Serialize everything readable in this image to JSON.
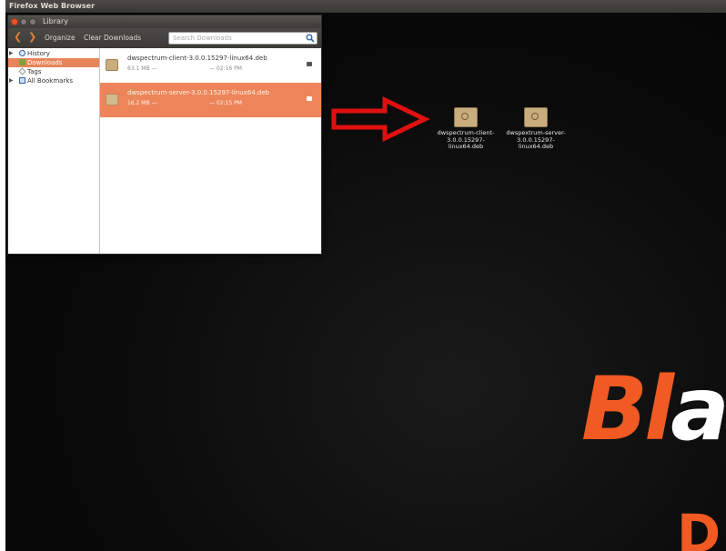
{
  "taskbar": {
    "title": "Firefox Web Browser"
  },
  "library": {
    "title": "Library",
    "toolbar": {
      "back_glyph": "❮",
      "forward_glyph": "❯",
      "organize_label": "Organize",
      "clear_downloads_label": "Clear Downloads",
      "search_placeholder": "Search Downloads"
    },
    "sidebar": {
      "items": [
        {
          "label": "History",
          "icon": "clock-icon"
        },
        {
          "label": "Downloads",
          "icon": "download-icon"
        },
        {
          "label": "Tags",
          "icon": "tag-icon"
        },
        {
          "label": "All Bookmarks",
          "icon": "bookmarks-icon"
        }
      ]
    },
    "downloads": [
      {
        "filename": "dwspectrum-client-3.0.0.15297-linux64.deb",
        "size": "63.1 MB —",
        "time": "— 02:16 PM",
        "selected": false
      },
      {
        "filename": "dwspectrum-server-3.0.0.15297-linux64.deb",
        "size": "16.2 MB —",
        "time": "— 02:15 PM",
        "selected": true
      }
    ]
  },
  "desktop": {
    "icons": [
      {
        "label": "dwspectrum-client-3.0.0.15297-linux64.deb",
        "icon": "debian-package-icon"
      },
      {
        "label": "dwspextrum-server-3.0.0.15297-linux64.deb",
        "icon": "debian-package-icon"
      }
    ],
    "brand_part1": "Bl",
    "brand_part2": "a",
    "brand_bottom": "D"
  },
  "colors": {
    "accent": "#ee855a",
    "brand_orange": "#f15a22",
    "arrow_red": "#e01010"
  }
}
